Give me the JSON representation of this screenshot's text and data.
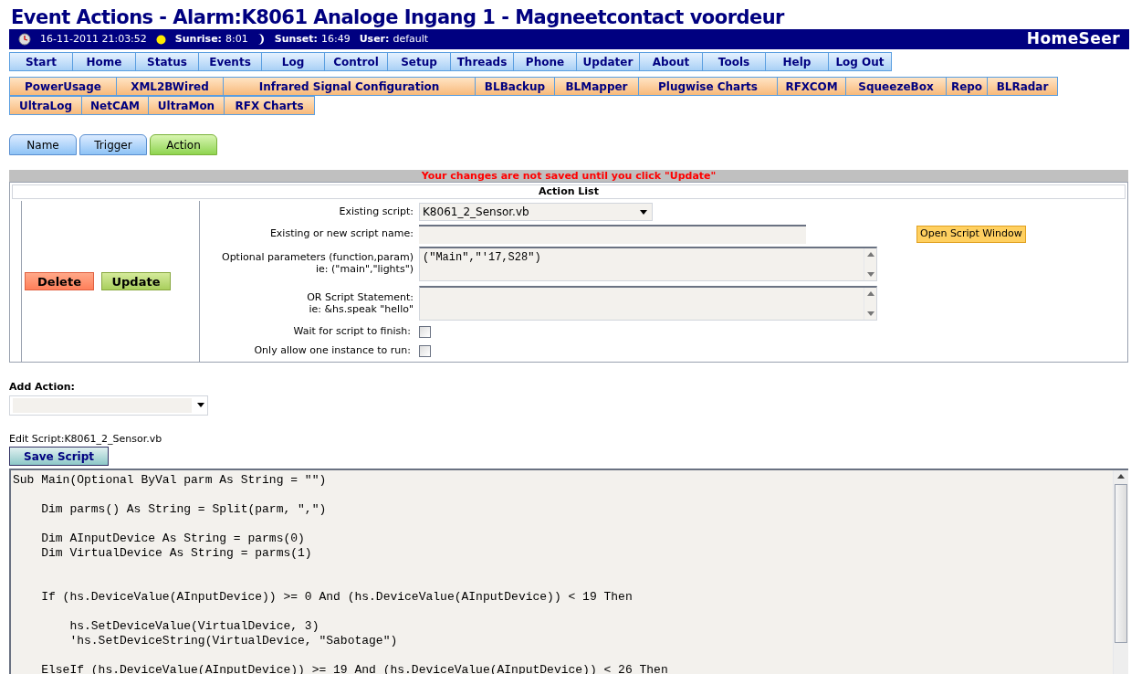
{
  "page_title": "Event Actions - Alarm:K8061 Analoge Ingang 1 - Magneetcontact voordeur",
  "status_bar": {
    "datetime": "16-11-2011 21:03:52",
    "sunrise_label": "Sunrise:",
    "sunrise": "8:01",
    "sunset_label": "Sunset:",
    "sunset": "16:49",
    "user_label": "User:",
    "user": "default",
    "logo": "HomeSeer"
  },
  "main_menu": [
    "Start",
    "Home",
    "Status",
    "Events",
    "Log",
    "Control",
    "Setup",
    "Threads",
    "Phone",
    "Updater",
    "About",
    "Tools",
    "Help",
    "Log Out"
  ],
  "plugin_menu_rows": [
    [
      "PowerUsage",
      "XML2BWired",
      "Infrared Signal Configuration",
      "BLBackup",
      "BLMapper",
      "Plugwise Charts",
      "RFXCOM",
      "SqueezeBox",
      "Repo",
      "BLRadar"
    ],
    [
      "UltraLog",
      "NetCAM",
      "UltraMon",
      "RFX Charts"
    ]
  ],
  "tabs": [
    {
      "label": "Name",
      "selected": false
    },
    {
      "label": "Trigger",
      "selected": false
    },
    {
      "label": "Action",
      "selected": true
    }
  ],
  "warning": "Your changes are not saved until you click \"Update\"",
  "action_list": {
    "title": "Action List",
    "delete": "Delete",
    "update": "Update",
    "existing_script": {
      "label": "Existing script:",
      "value": "K8061_2_Sensor.vb"
    },
    "script_name": {
      "label": "Existing or new script name:"
    },
    "open_script_window": "Open Script Window",
    "parameters": {
      "label": "Optional parameters (function,param)",
      "hint": "ie: (\"main\",\"lights\")",
      "value": "(\"Main\",\"'17,S28\")"
    },
    "statement": {
      "label": "OR Script Statement:",
      "hint": "ie: &hs.speak \"hello\""
    },
    "checkboxes": [
      {
        "label": "Wait for script to finish:",
        "checked": false
      },
      {
        "label": "Only allow one instance to run:",
        "checked": false
      }
    ]
  },
  "add_action": {
    "label": "Add Action:"
  },
  "editor": {
    "label": "Edit Script:K8061_2_Sensor.vb",
    "save": "Save Script",
    "lines": [
      {
        "kind": "code",
        "text": "Sub Main(Optional ByVal parm As String = \"\")"
      },
      {
        "kind": "blank"
      },
      {
        "kind": "code",
        "text": "    Dim parms() As String = Split(parm, \",\")"
      },
      {
        "kind": "blank"
      },
      {
        "kind": "code",
        "text": "    Dim AInputDevice As String = parms(0)"
      },
      {
        "kind": "code",
        "text": "    Dim VirtualDevice As String = parms(1)"
      },
      {
        "kind": "blank"
      },
      {
        "kind": "blank"
      },
      {
        "kind": "code",
        "text": "    If (hs.DeviceValue(AInputDevice)) >= 0 And (hs.DeviceValue(AInputDevice)) < 19 Then"
      },
      {
        "kind": "blank"
      },
      {
        "kind": "code",
        "text": "        hs.SetDeviceValue(VirtualDevice, 3)"
      },
      {
        "kind": "code",
        "text": "        'hs.SetDeviceString(VirtualDevice, \"Sabotage\")"
      },
      {
        "kind": "blank"
      },
      {
        "kind": "code",
        "text": "    ElseIf (hs.DeviceValue(AInputDevice)) >= 19 And (hs.DeviceValue(AInputDevice)) < 26 Then"
      }
    ]
  }
}
